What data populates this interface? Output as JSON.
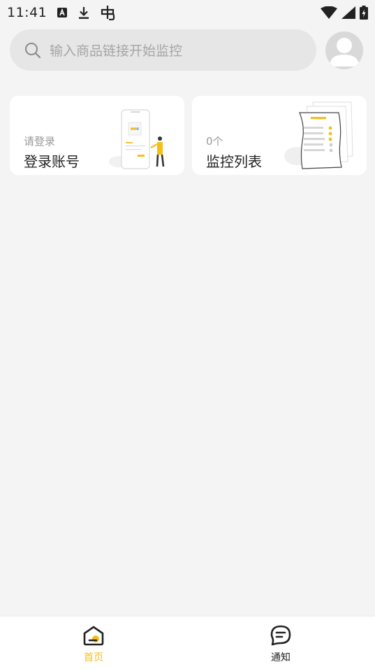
{
  "status_bar": {
    "time": "11:41",
    "icons_left": [
      "a-icon",
      "download-icon",
      "bug-icon"
    ],
    "icons_right": [
      "wifi-icon",
      "signal-icon",
      "battery-icon"
    ]
  },
  "search": {
    "placeholder": "输入商品链接开始监控",
    "icon": "search-icon"
  },
  "avatar": {
    "icon": "user-avatar-icon"
  },
  "cards": {
    "login": {
      "subtitle": "请登录",
      "title": "登录账号"
    },
    "monitor": {
      "subtitle": "0个",
      "title": "监控列表"
    }
  },
  "tabbar": {
    "home": {
      "label": "首页",
      "icon": "home-icon"
    },
    "notice": {
      "label": "通知",
      "icon": "chat-icon"
    }
  },
  "colors": {
    "accent": "#f5bf1b",
    "background": "#f4f4f4",
    "search_bg": "#e6e6e6"
  }
}
